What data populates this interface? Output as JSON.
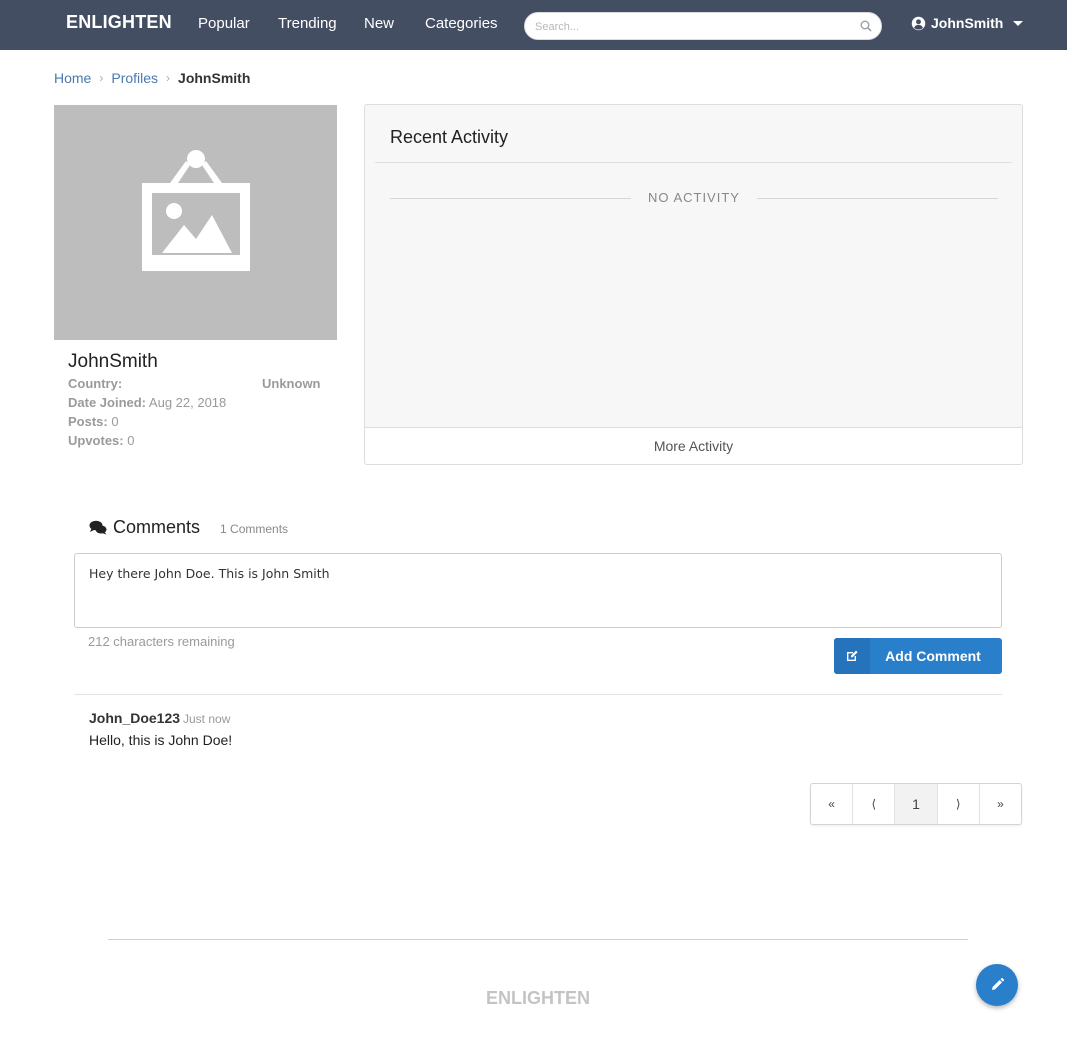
{
  "nav": {
    "brand": "ENLIGHTEN",
    "links": [
      "Popular",
      "Trending",
      "New",
      "Categories"
    ],
    "search_placeholder": "Search...",
    "user": "JohnSmith"
  },
  "breadcrumb": {
    "items": [
      "Home",
      "Profiles"
    ],
    "current": "JohnSmith"
  },
  "profile": {
    "name": "JohnSmith",
    "country_label": "Country:",
    "country_value": "Unknown",
    "date_joined_label": "Date Joined:",
    "date_joined_value": "Aug 22, 2018",
    "posts_label": "Posts:",
    "posts_value": "0",
    "upvotes_label": "Upvotes:",
    "upvotes_value": "0"
  },
  "activity": {
    "title": "Recent Activity",
    "empty_text": "NO ACTIVITY",
    "more_label": "More Activity"
  },
  "comments": {
    "title": "Comments",
    "count_text": "1 Comments",
    "draft_value": "Hey there John Doe. This is John Smith",
    "chars_remaining": "212 characters remaining",
    "add_label": "Add Comment",
    "items": [
      {
        "author": "John_Doe123",
        "time": "Just now",
        "text": "Hello, this is John Doe!"
      }
    ]
  },
  "pagination": {
    "first": "«",
    "prev": "⟨",
    "current": "1",
    "next": "⟩",
    "last": "»"
  },
  "footer": {
    "brand": "ENLIGHTEN"
  },
  "colors": {
    "nav_bg": "#434e63",
    "primary": "#2a7fca",
    "link": "#4a79ad"
  }
}
